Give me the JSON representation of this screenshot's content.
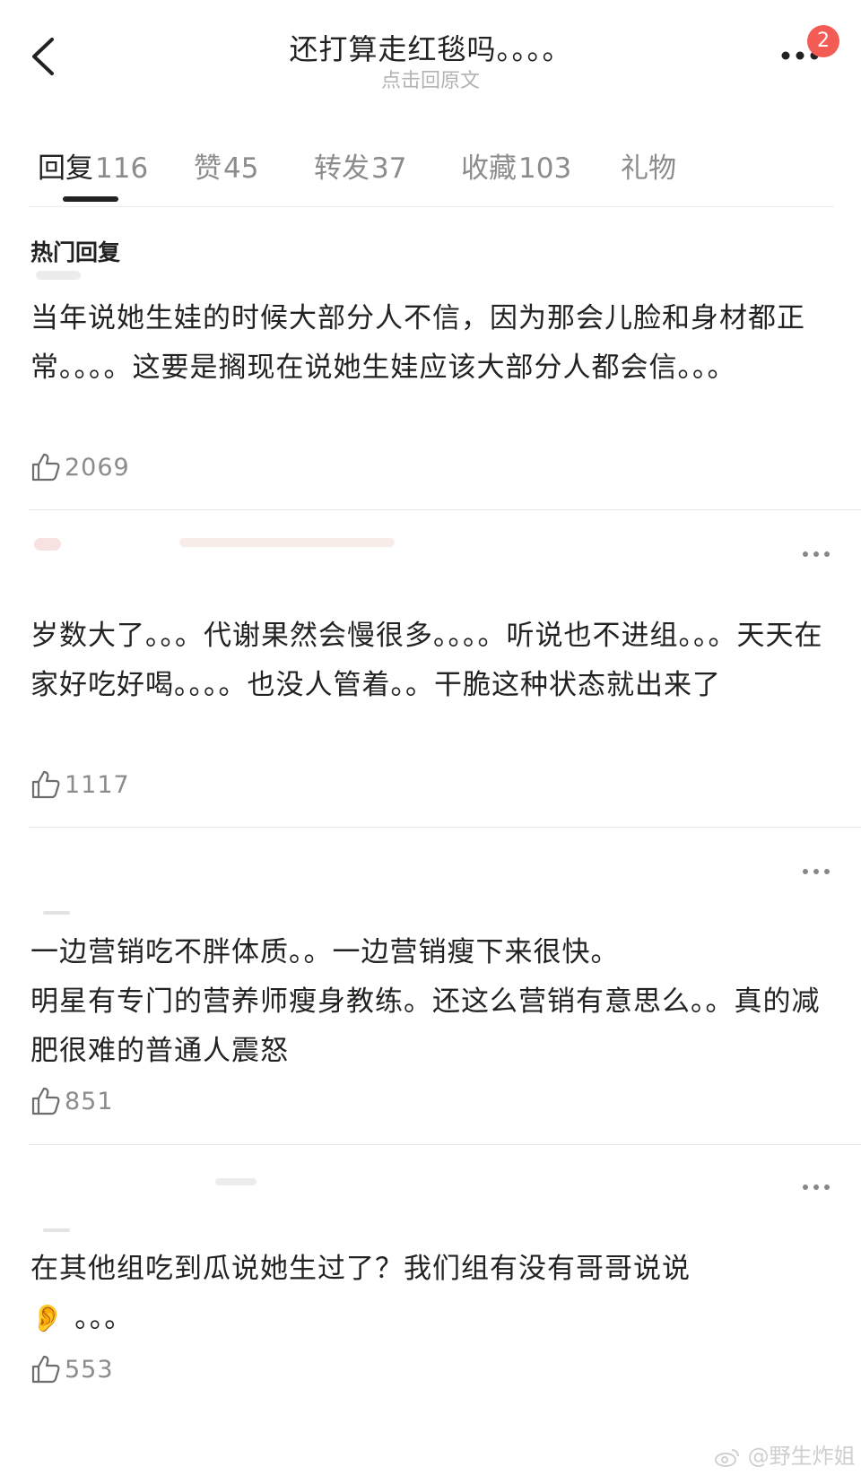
{
  "header": {
    "title": "还打算走红毯吗。。。。",
    "subtitle": "点击回原文",
    "badge_count": "2"
  },
  "tabs": [
    {
      "label": "回复",
      "count": "116",
      "active": true
    },
    {
      "label": "赞",
      "count": "45",
      "active": false
    },
    {
      "label": "转发",
      "count": "37",
      "active": false
    },
    {
      "label": "收藏",
      "count": "103",
      "active": false
    },
    {
      "label": "礼物",
      "count": "",
      "active": false
    }
  ],
  "section_title": "热门回复",
  "comments": [
    {
      "text": "当年说她生娃的时候大部分人不信，因为那会儿脸和身材都正常。。。。这要是搁现在说她生娃应该大部分人都会信。。。",
      "likes": "2069"
    },
    {
      "text": "岁数大了。。。代谢果然会慢很多。。。。听说也不进组。。。天天在家好吃好喝。。。。也没人管着。。干脆这种状态就出来了",
      "likes": "1117"
    },
    {
      "text_line1": "一边营销吃不胖体质。。一边营销瘦下来很快。",
      "text_line2": "明星有专门的营养师瘦身教练。还这么营销有意思么。。真的减肥很难的普通人震怒",
      "likes": "851"
    },
    {
      "text": "在其他组吃到瓜说她生过了？我们组有没有哥哥说说",
      "emoji": "👂",
      "text_tail": " 。。。",
      "likes": "553"
    }
  ],
  "watermark": "@野生炸姐",
  "icons": [
    "back-chevron-icon",
    "more-dots-icon",
    "thumb-up-icon",
    "weibo-logo-icon"
  ],
  "colors": {
    "badge": "#f25c54",
    "muted": "#8c8c8c",
    "text": "#222222"
  }
}
